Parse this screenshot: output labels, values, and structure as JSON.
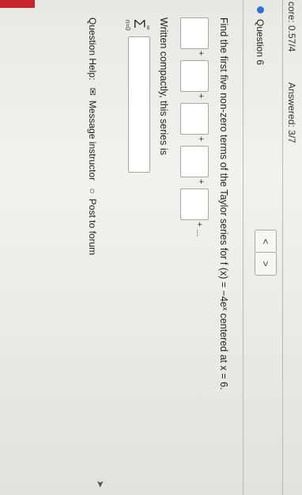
{
  "status": {
    "score_text": "core: 0.57/4",
    "answered_text": "Answered: 3/7"
  },
  "question_select": {
    "label": "Question 6",
    "caret": "▼"
  },
  "nav": {
    "prev": "<",
    "next": ">"
  },
  "question": {
    "prompt": "Find the first five non-zero terms of the Taylor series for f (x) = −4eˣ centered at x = 6.",
    "plus": "+",
    "ellipsis": "+ ...",
    "compact_text": "Written compactly, this series is",
    "sum_symbol": "Σ",
    "sum_upper": "∞",
    "sum_lower": "n=0"
  },
  "help": {
    "label": "Question Help:",
    "message_icon": "✉",
    "message_text": "Message instructor",
    "forum_icon": "○",
    "forum_text": "Post to forum"
  },
  "colors": {
    "accent": "#2d6fd6",
    "red_bar": "#c8242b"
  }
}
